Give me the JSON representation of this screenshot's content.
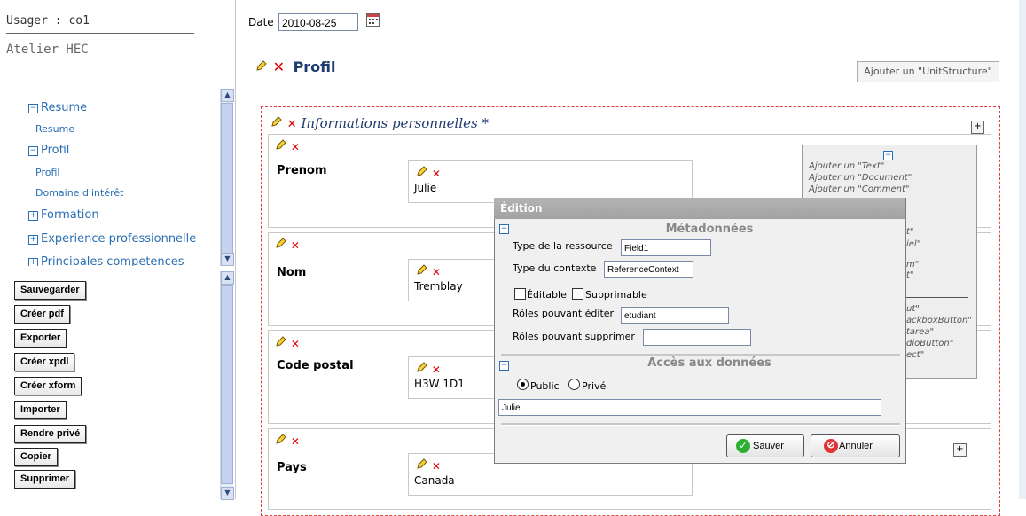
{
  "user": {
    "label": "Usager : co1",
    "workshop": "Atelier HEC"
  },
  "nav": {
    "items": [
      {
        "label": "Resume",
        "level": "top",
        "toggle": "−"
      },
      {
        "label": "Resume",
        "level": "sub"
      },
      {
        "label": "Profil",
        "level": "top",
        "toggle": "−"
      },
      {
        "label": "Profil",
        "level": "sub"
      },
      {
        "label": "Domaine d'intérêt",
        "level": "sub"
      },
      {
        "label": "Formation",
        "level": "top",
        "toggle": "+"
      },
      {
        "label": "Experience professionnelle",
        "level": "top",
        "toggle": "+"
      },
      {
        "label": "Principales competences",
        "level": "top",
        "toggle": "+"
      }
    ]
  },
  "actions": {
    "save": "Sauvegarder",
    "create_pdf": "Créer pdf",
    "export": "Exporter",
    "create_xpdl": "Créer xpdl",
    "create_xform": "Créer xform",
    "import": "Importer",
    "make_private": "Rendre privé",
    "copy": "Copier",
    "delete": "Supprimer"
  },
  "date": {
    "label": "Date",
    "value": "2010-08-25"
  },
  "profile": {
    "title": "Profil",
    "add_unit_button": "Ajouter un \"UnitStructure\""
  },
  "info_section": {
    "title": "Informations personnelles",
    "required_mark": "*"
  },
  "fields": [
    {
      "label": "Prenom",
      "value": "Julie"
    },
    {
      "label": "Nom",
      "value": "Tremblay"
    },
    {
      "label": "Code postal",
      "value": "H3W 1D1"
    },
    {
      "label": "Pays",
      "value": "Canada"
    }
  ],
  "side_panel": {
    "items": [
      "Ajouter un \"Text\"",
      "Ajouter un \"Document\"",
      "Ajouter un \"Comment\"",
      "t\"",
      "iel\"",
      "m\"",
      "t\"",
      "ut\"",
      "ackboxButton\"",
      "tarea\"",
      "dioButton\"",
      "ect\""
    ]
  },
  "dialog": {
    "title": "Édition",
    "metadata_header": "Métadonnées",
    "resource_type_label": "Type de la ressource",
    "resource_type_value": "Field1",
    "context_type_label": "Type du contexte",
    "context_type_value": "ReferenceContext",
    "editable_label": "Éditable",
    "deletable_label": "Supprimable",
    "edit_roles_label": "Rôles pouvant éditer",
    "edit_roles_value": "etudiant",
    "delete_roles_label": "Rôles pouvant supprimer",
    "delete_roles_value": "",
    "access_header": "Accès aux données",
    "public_label": "Public",
    "private_label": "Privé",
    "access_value": "Julie",
    "save_button": "Sauver",
    "cancel_button": "Annuler"
  },
  "colors": {
    "link": "#2a6fb5",
    "title": "#1e3a6f",
    "delete": "#dd0000",
    "dashed_border": "#e04040"
  }
}
